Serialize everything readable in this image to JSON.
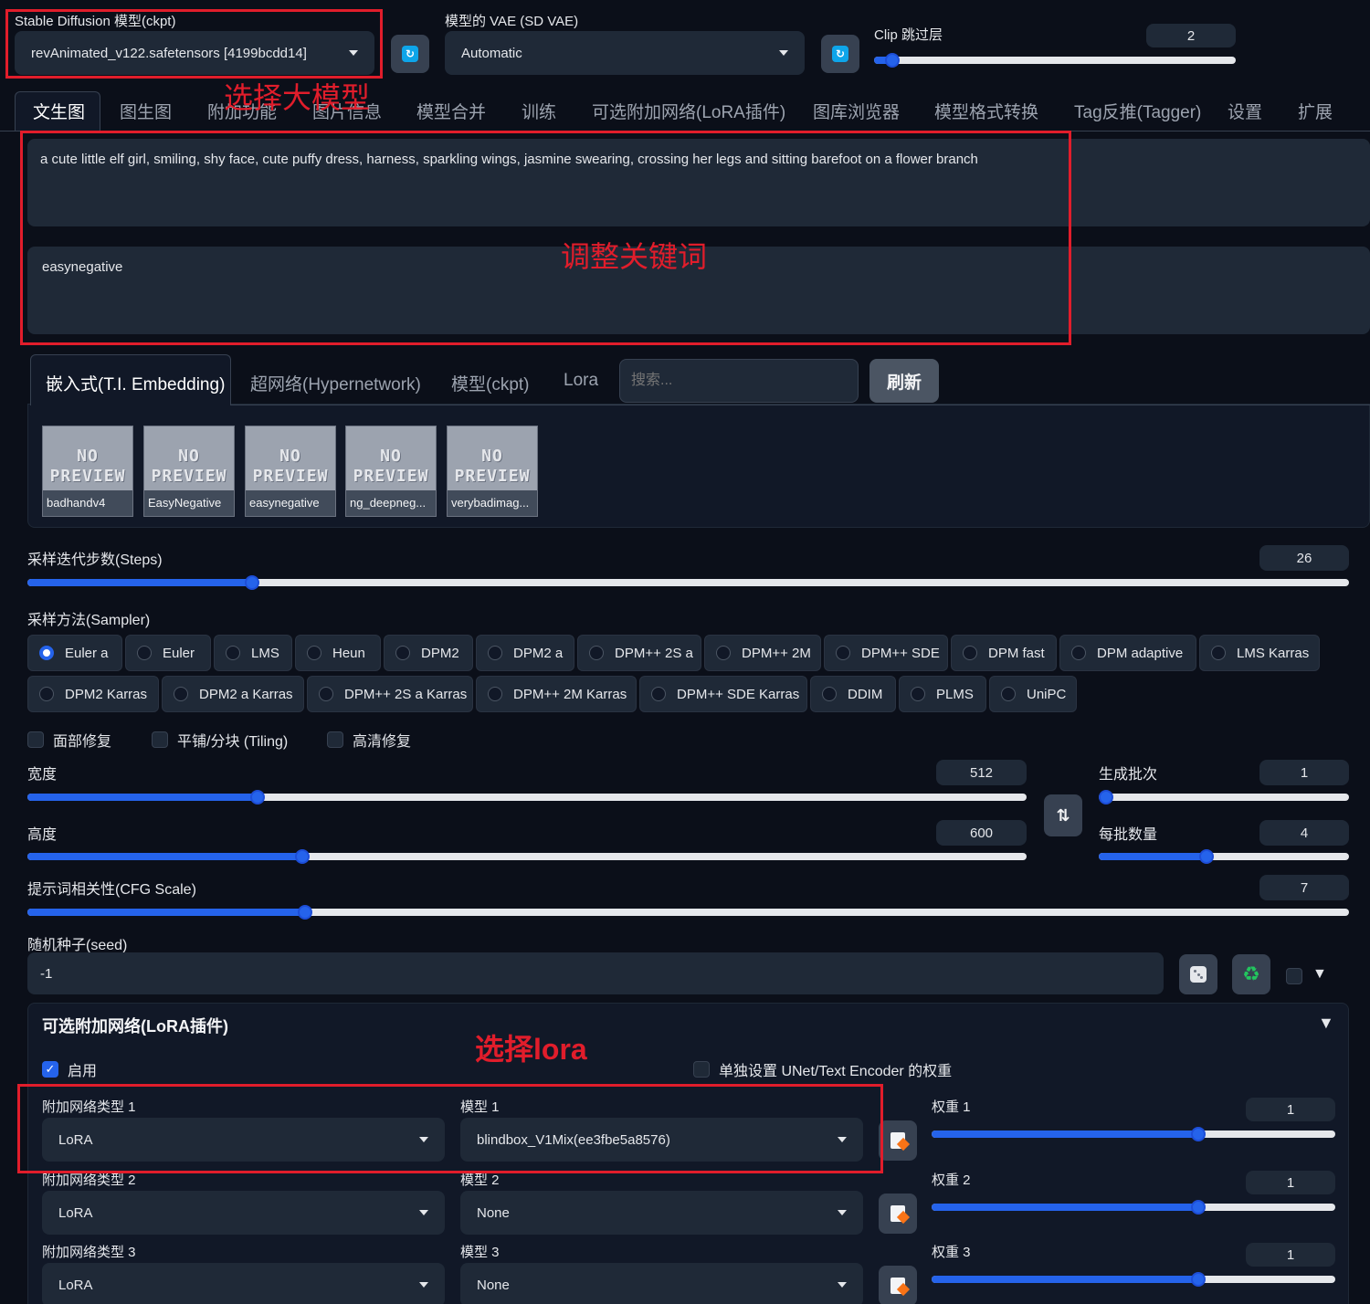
{
  "top": {
    "ckpt_label": "Stable Diffusion 模型(ckpt)",
    "ckpt_value": "revAnimated_v122.safetensors [4199bcdd14]",
    "vae_label": "模型的 VAE (SD VAE)",
    "vae_value": "Automatic",
    "clip_label": "Clip 跳过层",
    "clip_value": "2",
    "clip_level": 0.05
  },
  "tabs": [
    "文生图",
    "图生图",
    "附加功能",
    "图片信息",
    "模型合并",
    "训练",
    "可选附加网络(LoRA插件)",
    "图库浏览器",
    "模型格式转换",
    "Tag反推(Tagger)",
    "设置",
    "扩展"
  ],
  "prompt": {
    "positive": "a cute little elf girl, smiling, shy face, cute puffy dress, harness, sparkling wings, jasmine swearing, crossing her legs and sitting barefoot on a flower branch",
    "negative": "easynegative"
  },
  "network_tabs": {
    "items": [
      "嵌入式(T.I. Embedding)",
      "超网络(Hypernetwork)",
      "模型(ckpt)",
      "Lora"
    ],
    "search_placeholder": "搜索...",
    "refresh_label": "刷新",
    "no_preview_text": "NO PREVIEW",
    "cards": [
      "badhandv4",
      "EasyNegative",
      "easynegative",
      "ng_deepneg...",
      "verybadimag..."
    ]
  },
  "steps": {
    "label": "采样迭代步数(Steps)",
    "value": "26",
    "level": 0.17
  },
  "sampler": {
    "label": "采样方法(Sampler)",
    "row1": [
      "Euler a",
      "Euler",
      "LMS",
      "Heun",
      "DPM2",
      "DPM2 a",
      "DPM++ 2S a",
      "DPM++ 2M",
      "DPM++ SDE",
      "DPM fast",
      "DPM adaptive",
      "LMS Karras"
    ],
    "row2": [
      "DPM2 Karras",
      "DPM2 a Karras",
      "DPM++ 2S a Karras",
      "DPM++ 2M Karras",
      "DPM++ SDE Karras",
      "DDIM",
      "PLMS",
      "UniPC"
    ],
    "selected": "Euler a"
  },
  "options": {
    "face_restore": "面部修复",
    "tiling": "平铺/分块 (Tiling)",
    "hires": "高清修复"
  },
  "size": {
    "width_label": "宽度",
    "width_value": "512",
    "width_level": 0.23,
    "height_label": "高度",
    "height_value": "600",
    "height_level": 0.275,
    "batch_count_label": "生成批次",
    "batch_count_value": "1",
    "batch_count_level": 0.0,
    "batch_size_label": "每批数量",
    "batch_size_value": "4",
    "batch_size_level": 0.43,
    "swap_icon": "swap-vertical-icon"
  },
  "cfg": {
    "label": "提示词相关性(CFG Scale)",
    "value": "7",
    "level": 0.21
  },
  "seed": {
    "label": "随机种子(seed)",
    "value": "-1",
    "dice_icon": "dice-icon",
    "recycle_icon": "recycle-icon"
  },
  "lora": {
    "title": "可选附加网络(LoRA插件)",
    "enable_label": "启用",
    "separate_label": "单独设置 UNet/Text Encoder 的权重",
    "rows": [
      {
        "type_label": "附加网络类型 1",
        "type_value": "LoRA",
        "model_label": "模型 1",
        "model_value": "blindbox_V1Mix(ee3fbe5a8576)",
        "weight_label": "权重 1",
        "weight_value": "1",
        "weight_level": 0.66
      },
      {
        "type_label": "附加网络类型 2",
        "type_value": "LoRA",
        "model_label": "模型 2",
        "model_value": "None",
        "weight_label": "权重 2",
        "weight_value": "1",
        "weight_level": 0.66
      },
      {
        "type_label": "附加网络类型 3",
        "type_value": "LoRA",
        "model_label": "模型 3",
        "model_value": "None",
        "weight_label": "权重 3",
        "weight_value": "1",
        "weight_level": 0.66
      }
    ]
  },
  "annotations": {
    "model": "选择大模型",
    "keywords": "调整关键词",
    "lora": "选择lora"
  },
  "colors": {
    "accent": "#2563eb",
    "annotation": "#e11d2b",
    "background": "#0b0f19"
  }
}
